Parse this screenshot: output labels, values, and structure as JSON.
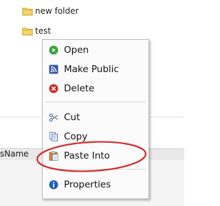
{
  "tree": {
    "items": [
      {
        "label": "new folder"
      },
      {
        "label": "test"
      }
    ]
  },
  "panel": {
    "field_label_partial": "sName"
  },
  "context_menu": {
    "items": [
      {
        "label": "Open",
        "icon": "play-icon"
      },
      {
        "label": "Make Public",
        "icon": "rss-icon"
      },
      {
        "label": "Delete",
        "icon": "delete-icon"
      },
      {
        "label": "Cut",
        "icon": "scissors-icon"
      },
      {
        "label": "Copy",
        "icon": "copy-icon"
      },
      {
        "label": "Paste Into",
        "icon": "paste-icon"
      },
      {
        "label": "Properties",
        "icon": "info-icon"
      }
    ]
  },
  "colors": {
    "highlight_ring": "#d9282a",
    "folder": "#f2c235"
  }
}
